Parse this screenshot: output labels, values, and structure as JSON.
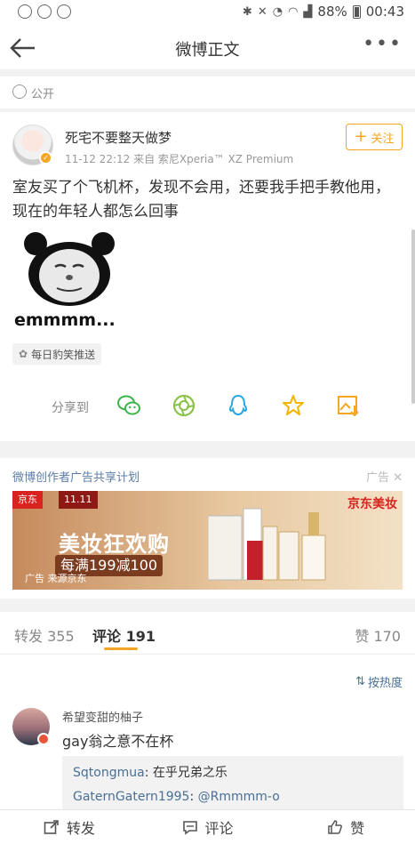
{
  "status_bar": {
    "battery": "88%",
    "time": "00:43"
  },
  "nav": {
    "title": "微博正文"
  },
  "visibility": {
    "label": "公开"
  },
  "post": {
    "username": "死宅不要整天做梦",
    "meta": "11-12 22:12   来自 索尼Xperia™ XZ Premium",
    "follow_label": "关注",
    "text": "室友买了个飞机杯，发现不会用，还要我手把手教他用，现在的年轻人都怎么回事",
    "image_caption": "emmmm...",
    "source_tag": "每日豹笑推送",
    "share_label": "分享到"
  },
  "ad": {
    "title": "微博创作者广告共享计划",
    "tag": "广告 ✕",
    "banner": {
      "jd_logo": "京东",
      "eleven": "11.11",
      "jd_beauty": "京东美妆",
      "headline": "美妆狂欢购",
      "promo": "每满199减100",
      "source": "广告 来源京东"
    }
  },
  "tabs": {
    "repost": "转发 355",
    "comments": "评论 191",
    "likes": "赞 170",
    "sort_label": "按热度"
  },
  "comment": {
    "name": "希望变甜的柚子",
    "text": "gay翁之意不在杯",
    "replies": [
      {
        "name": "Sqtongmua",
        "text": ": 在乎兄弟之乐"
      },
      {
        "name": "GaternGatern1995",
        "text": ": ",
        "mention": "@Rmmmm-o"
      }
    ]
  },
  "bottom_bar": {
    "repost": "转发",
    "comment": "评论",
    "like": "赞"
  },
  "colors": {
    "accent": "#f5a623",
    "link": "#4a6f96"
  }
}
